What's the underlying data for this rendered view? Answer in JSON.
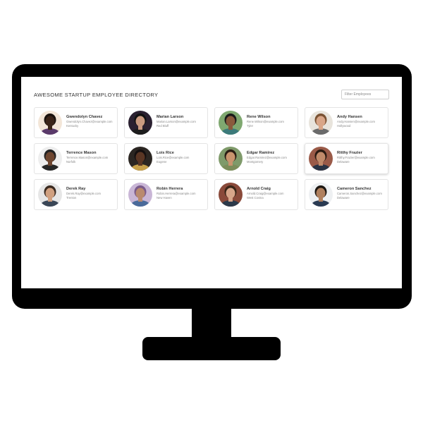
{
  "header": {
    "title": "AWESOME STARTUP EMPLOYEE DIRECTORY",
    "filter_placeholder": "Filter Employees"
  },
  "employees": [
    {
      "name": "Gwendolyn Chavez",
      "email": "Gwendolyn.Chavez@example.com",
      "city": "Kentucky",
      "bg": "#f3e6d8",
      "skin": "#3b2418",
      "hair": "#1a120d",
      "shirt": "#5a3a6a"
    },
    {
      "name": "Marian Larson",
      "email": "Marian.Larson@example.com",
      "city": "Red Bluff",
      "bg": "#2a2030",
      "skin": "#c99a80",
      "hair": "#111111",
      "shirt": "#1d1d1d"
    },
    {
      "name": "Rene Wilson",
      "email": "Rene.Wilson@example.com",
      "city": "Tyler",
      "bg": "#7fa870",
      "skin": "#8a5a3c",
      "hair": "#1a1a1a",
      "shirt": "#3b7a7a"
    },
    {
      "name": "Andy Hansen",
      "email": "Andy.Hansen@example.com",
      "city": "Hollywood",
      "bg": "#e8e4dc",
      "skin": "#d9a688",
      "hair": "#7a5233",
      "shirt": "#6a6a6a"
    },
    {
      "name": "Terrence Mason",
      "email": "Terrence.Mason@example.com",
      "city": "Norfolk",
      "bg": "#eeeeee",
      "skin": "#6e4630",
      "hair": "#222222",
      "shirt": "#262626"
    },
    {
      "name": "Lois Rice",
      "email": "Lois.Rice@example.com",
      "city": "Eugene",
      "bg": "#2b2622",
      "skin": "#5a3624",
      "hair": "#151010",
      "shirt": "#c7a04a"
    },
    {
      "name": "Edgar Ramirez",
      "email": "Edgar.Ramirez@example.com",
      "city": "Montgomery",
      "bg": "#7f9a6a",
      "skin": "#c9946e",
      "hair": "#2a1d14",
      "shirt": "#7c8c5a"
    },
    {
      "name": "Ritthy Frazier",
      "email": "Ritthy.Frazier@example.com",
      "city": "Delaware",
      "bg": "#9a5a48",
      "skin": "#c08a6a",
      "hair": "#2a1a12",
      "shirt": "#2a3344"
    },
    {
      "name": "Derek Ray",
      "email": "Derek.Ray@example.com",
      "city": "Trenton",
      "bg": "#e6e6e6",
      "skin": "#d0a080",
      "hair": "#3a2a20",
      "shirt": "#3a4656"
    },
    {
      "name": "Robin Herrera",
      "email": "Robin.Herrera@example.com",
      "city": "New Haven",
      "bg": "#c9b6d6",
      "skin": "#b98a6e",
      "hair": "#7a5a8a",
      "shirt": "#4a6a9a"
    },
    {
      "name": "Arnold Craig",
      "email": "Arnold.Craig@example.com",
      "city": "West Covina",
      "bg": "#8a4a3a",
      "skin": "#d8a68a",
      "hair": "#3a2618",
      "shirt": "#2c3a4a"
    },
    {
      "name": "Cameron Sanchez",
      "email": "Cameron.Sanchez@example.com",
      "city": "Delaware",
      "bg": "#eef0f2",
      "skin": "#b0805e",
      "hair": "#1d1712",
      "shirt": "#2a3a52"
    }
  ]
}
